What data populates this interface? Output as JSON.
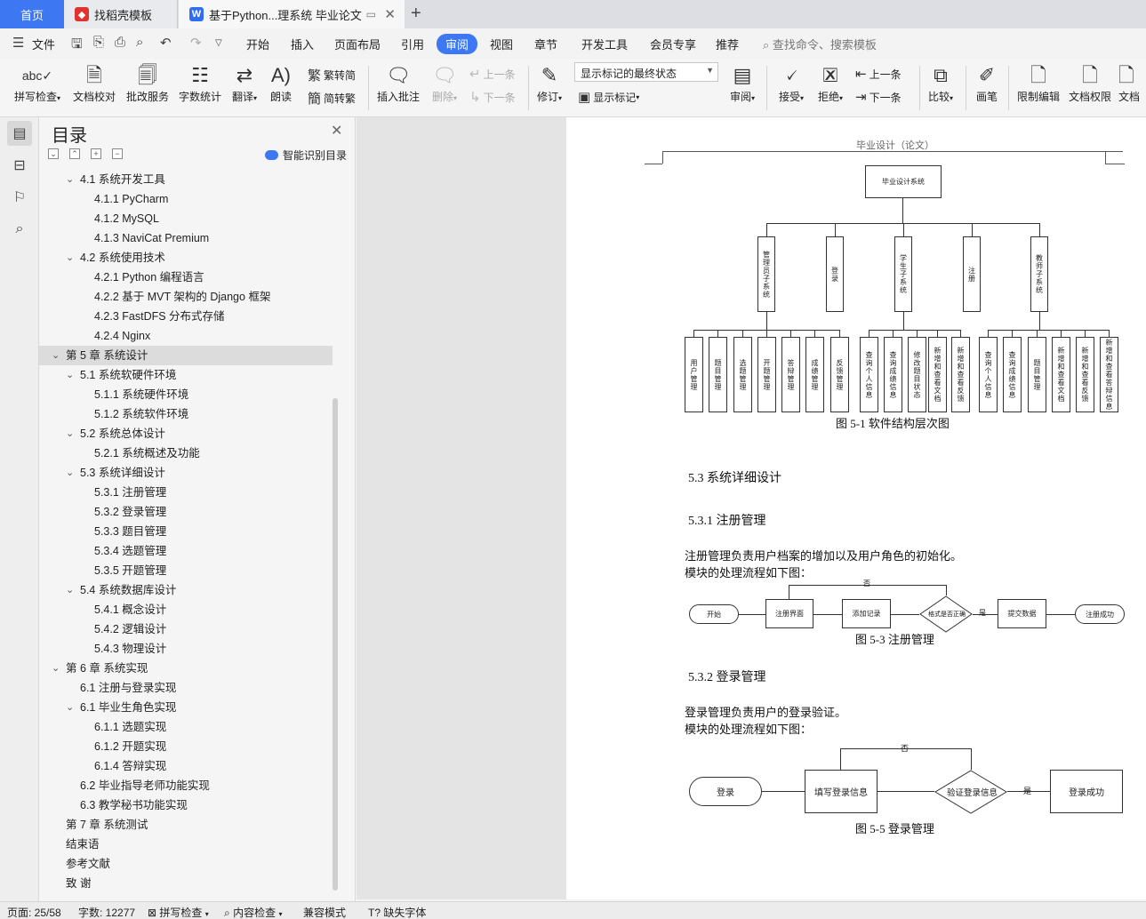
{
  "tabs": [
    {
      "label": "首页",
      "icon": "home-icon"
    },
    {
      "label": "找稻壳模板",
      "icon": "docer-icon"
    },
    {
      "label": "基于Python...理系统 毕业论文",
      "icon": "wps-writer-icon"
    }
  ],
  "menu": {
    "file": "文件",
    "items": [
      "开始",
      "插入",
      "页面布局",
      "引用",
      "审阅",
      "视图",
      "章节",
      "开发工具",
      "会员专享",
      "推荐"
    ],
    "active": "审阅",
    "search_placeholder": "查找命令、搜索模板"
  },
  "ribbon": {
    "spell_check": "拼写检查",
    "doc_proof": "文档校对",
    "batch_service": "批改服务",
    "word_count": "字数统计",
    "translate": "翻译",
    "read_aloud": "朗读",
    "trad_to_simp": "繁转简",
    "simp_to_trad": "简转繁",
    "insert_comment": "插入批注",
    "delete": "删除",
    "prev_comment": "上一条",
    "next_comment": "下一条",
    "track_changes": "修订",
    "markup_state": "显示标记的最终状态",
    "show_markup": "显示标记",
    "review": "审阅",
    "accept": "接受",
    "reject": "拒绝",
    "prev_change": "上一条",
    "next_change": "下一条",
    "compare": "比较",
    "pen": "画笔",
    "restrict_edit": "限制编辑",
    "doc_permission": "文档权限",
    "doc_extra": "文档"
  },
  "toc": {
    "title": "目录",
    "smart_label": "智能识别目录",
    "items": [
      {
        "level": 2,
        "chev": true,
        "label": "4.1  系统开发工具"
      },
      {
        "level": 3,
        "chev": false,
        "label": "4.1.1 PyCharm"
      },
      {
        "level": 3,
        "chev": false,
        "label": "4.1.2 MySQL"
      },
      {
        "level": 3,
        "chev": false,
        "label": "4.1.3 NaviCat Premium"
      },
      {
        "level": 2,
        "chev": true,
        "label": "4.2  系统使用技术"
      },
      {
        "level": 3,
        "chev": false,
        "label": "4.2.1 Python 编程语言"
      },
      {
        "level": 3,
        "chev": false,
        "label": "4.2.2 基于 MVT 架构的 Django 框架"
      },
      {
        "level": 3,
        "chev": false,
        "label": "4.2.3 FastDFS 分布式存储"
      },
      {
        "level": 3,
        "chev": false,
        "label": "4.2.4 Nginx"
      },
      {
        "level": 1,
        "chev": true,
        "label": "第 5 章  系统设计",
        "selected": true
      },
      {
        "level": 2,
        "chev": true,
        "label": "5.1 系统软硬件环境"
      },
      {
        "level": 3,
        "chev": false,
        "label": "5.1.1  系统硬件环境"
      },
      {
        "level": 3,
        "chev": false,
        "label": "5.1.2  系统软件环境"
      },
      {
        "level": 2,
        "chev": true,
        "label": "5.2 系统总体设计"
      },
      {
        "level": 3,
        "chev": false,
        "label": "5.2.1 系统概述及功能"
      },
      {
        "level": 2,
        "chev": true,
        "label": "5.3 系统详细设计"
      },
      {
        "level": 3,
        "chev": false,
        "label": "5.3.1  注册管理"
      },
      {
        "level": 3,
        "chev": false,
        "label": "5.3.2  登录管理"
      },
      {
        "level": 3,
        "chev": false,
        "label": "5.3.3  题目管理"
      },
      {
        "level": 3,
        "chev": false,
        "label": "5.3.4  选题管理"
      },
      {
        "level": 3,
        "chev": false,
        "label": "5.3.5  开题管理"
      },
      {
        "level": 2,
        "chev": true,
        "label": "5.4 系统数据库设计"
      },
      {
        "level": 3,
        "chev": false,
        "label": "5.4.1  概念设计"
      },
      {
        "level": 3,
        "chev": false,
        "label": "5.4.2  逻辑设计"
      },
      {
        "level": 3,
        "chev": false,
        "label": "5.4.3  物理设计"
      },
      {
        "level": 1,
        "chev": true,
        "label": "第 6 章  系统实现"
      },
      {
        "level": 2,
        "chev": false,
        "label": "6.1  注册与登录实现"
      },
      {
        "level": 2,
        "chev": true,
        "label": "6.1 毕业生角色实现"
      },
      {
        "level": 3,
        "chev": false,
        "label": "6.1.1 选题实现"
      },
      {
        "level": 3,
        "chev": false,
        "label": "6.1.2  开题实现"
      },
      {
        "level": 3,
        "chev": false,
        "label": "6.1.4  答辩实现"
      },
      {
        "level": 2,
        "chev": false,
        "label": "6.2  毕业指导老师功能实现"
      },
      {
        "level": 2,
        "chev": false,
        "label": "6.3  教学秘书功能实现"
      },
      {
        "level": 1,
        "chev": false,
        "label": "第 7 章  系统测试"
      },
      {
        "level": 1,
        "chev": false,
        "label": "结束语"
      },
      {
        "level": 1,
        "chev": false,
        "label": "参考文献"
      },
      {
        "level": 1,
        "chev": false,
        "label": "致  谢"
      }
    ]
  },
  "document": {
    "page_header": "毕业设计（论文）",
    "structure_chart": {
      "root": "毕业设计系统",
      "subsystems": [
        "管理员子系统",
        "登录",
        "学生子系统",
        "注册",
        "教师子系统"
      ],
      "leaves": [
        "用户管理",
        "题目管理",
        "选题管理",
        "开题管理",
        "答辩管理",
        "成绩管理",
        "反馈管理",
        "查询个人信息",
        "查询成绩信息",
        "修改题目状态",
        "新增和查看文档",
        "新增和查看反馈",
        "查询个人信息",
        "查询成绩信息",
        "题目管理",
        "新增和查看文档",
        "新增和查看反馈",
        "新增和查看答辩信息"
      ],
      "caption": "图 5-1    软件结构层次图"
    },
    "section_53": "5.3 系统详细设计",
    "section_531": "5.3.1  注册管理",
    "para_531_1": "注册管理负责用户档案的增加以及用户角色的初始化。",
    "para_531_2": "模块的处理流程如下图：",
    "flow_register": {
      "start": "开始",
      "page": "注册界面",
      "add": "添加记录",
      "check": "格式是否正确",
      "no": "否",
      "yes": "是",
      "submit": "提交数据",
      "success": "注册成功",
      "caption": "图 5-3  注册管理"
    },
    "section_532": "5.3.2  登录管理",
    "para_532_1": "登录管理负责用户的登录验证。",
    "para_532_2": "模块的处理流程如下图：",
    "flow_login": {
      "start": "登录",
      "fill": "填写登录信息",
      "check": "验证登录信息",
      "no": "否",
      "yes": "是",
      "success": "登录成功",
      "caption": "图 5-5  登录管理"
    }
  },
  "status": {
    "page": "页面: 25/58",
    "words": "字数: 12277",
    "spell": "拼写检查",
    "content": "内容检查",
    "compat": "兼容模式",
    "missing_font": "缺失字体"
  }
}
